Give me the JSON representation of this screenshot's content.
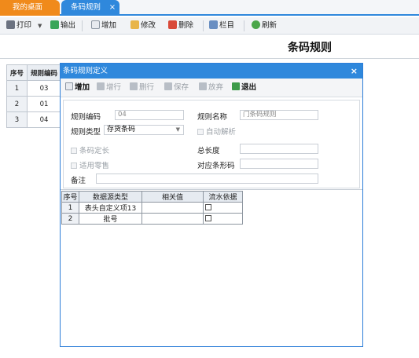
{
  "tabs": {
    "home": "我的桌面",
    "rule": "条码规则",
    "close": "×"
  },
  "toolbar": {
    "print": "打印",
    "print_arrow": "▼",
    "export": "输出",
    "add": "增加",
    "edit": "修改",
    "delete": "删除",
    "columns": "栏目",
    "refresh": "刷新"
  },
  "page": {
    "title": "条码规则"
  },
  "grid": {
    "headers": [
      "序号",
      "规则编码"
    ],
    "rows": [
      {
        "num": "1",
        "code": "03"
      },
      {
        "num": "2",
        "code": "01"
      },
      {
        "num": "3",
        "code": "04"
      }
    ]
  },
  "modal": {
    "title": "条码规则定义",
    "close": "×",
    "toolbar": {
      "add": "增加",
      "add_row": "增行",
      "del_row": "删行",
      "save": "保存",
      "discard": "放弃",
      "exit": "退出"
    },
    "form": {
      "rule_code_label": "规则编码",
      "rule_code_value": "04",
      "rule_name_label": "规则名称",
      "rule_name_value": "门条码规则",
      "rule_type_label": "规则类型",
      "rule_type_value": "存货条码",
      "auto_parse_label": "自动解析",
      "fixed_length_label": "条码定长",
      "total_length_label": "总长度",
      "total_length_value": "",
      "retail_label": "适用零售",
      "barcode_label": "对应条形码",
      "barcode_value": "",
      "remark_label": "备注",
      "remark_value": ""
    },
    "detail": {
      "headers": [
        "序号",
        "数据源类型",
        "相关值",
        "流水依据"
      ],
      "rows": [
        {
          "num": "1",
          "source": "表头自定义项13",
          "value": ""
        },
        {
          "num": "2",
          "source": "批号",
          "value": ""
        }
      ]
    }
  },
  "colors": {
    "accent": "#2f88dc",
    "home_tab": "#f08a1b"
  }
}
